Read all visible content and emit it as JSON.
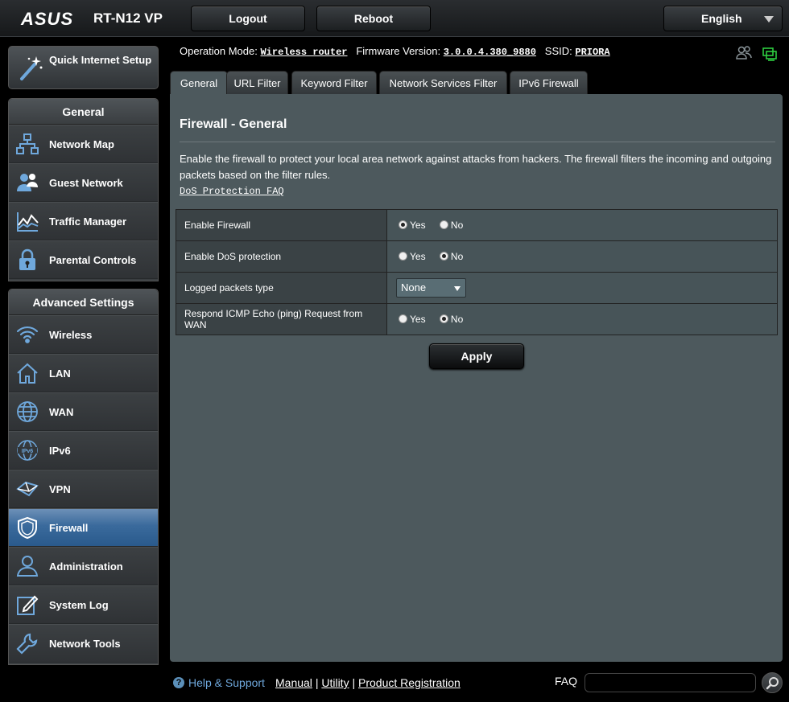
{
  "header": {
    "brand": "ASUS",
    "model": "RT-N12 VP",
    "logout_label": "Logout",
    "reboot_label": "Reboot",
    "language": "English"
  },
  "sidebar": {
    "quick_setup": "Quick Internet Setup",
    "general_title": "General",
    "general_items": [
      "Network Map",
      "Guest Network",
      "Traffic Manager",
      "Parental Controls"
    ],
    "advanced_title": "Advanced Settings",
    "advanced_items": [
      "Wireless",
      "LAN",
      "WAN",
      "IPv6",
      "VPN",
      "Firewall",
      "Administration",
      "System Log",
      "Network Tools"
    ],
    "active_item": "Firewall"
  },
  "info": {
    "op_mode_label": "Operation Mode:",
    "op_mode_value": "Wireless router",
    "fw_label": "Firmware Version:",
    "fw_value": "3.0.0.4.380_9880",
    "ssid_label": "SSID:",
    "ssid_value": "PRIORA"
  },
  "tabs": [
    "General",
    "URL Filter",
    "Keyword Filter",
    "Network Services Filter",
    "IPv6 Firewall"
  ],
  "panel": {
    "title": "Firewall - General",
    "description": "Enable the firewall to protect your local area network against attacks from hackers. The firewall filters the incoming and outgoing packets based on the filter rules.",
    "dos_link": "DoS Protection FAQ",
    "settings": [
      {
        "label": "Enable Firewall",
        "type": "radio",
        "selected": "Yes"
      },
      {
        "label": "Enable DoS protection",
        "type": "radio",
        "selected": "No"
      },
      {
        "label": "Logged packets type",
        "type": "select",
        "value": "None"
      },
      {
        "label": "Respond ICMP Echo (ping) Request from WAN",
        "type": "radio",
        "selected": "No"
      }
    ],
    "yes_label": "Yes",
    "no_label": "No",
    "apply_label": "Apply"
  },
  "footer": {
    "help_label": "Help & Support",
    "manual": "Manual",
    "utility": "Utility",
    "product_registration": "Product Registration",
    "separator": "|",
    "faq_label": "FAQ"
  },
  "colors": {
    "accent_blue": "#6fa8dc",
    "active_nav": "#3a6a9c",
    "panel_bg": "#4d595d",
    "status_green": "#2ecc40"
  }
}
